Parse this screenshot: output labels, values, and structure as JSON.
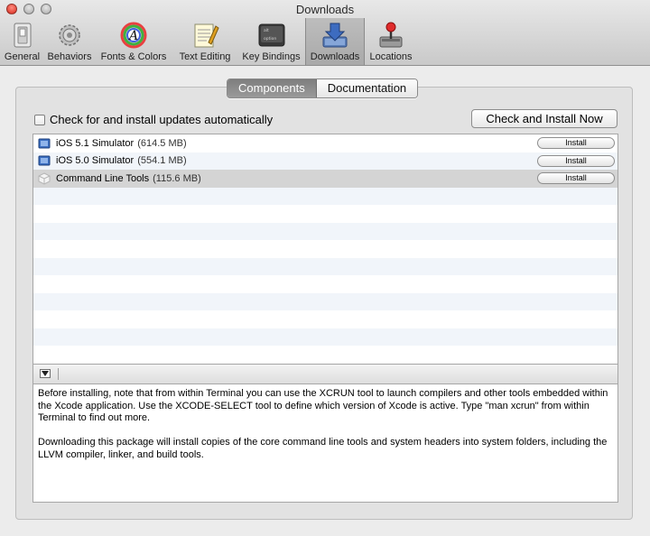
{
  "window": {
    "title": "Downloads"
  },
  "toolbar": {
    "items": [
      {
        "label": "General",
        "icon": "general-switch-icon"
      },
      {
        "label": "Behaviors",
        "icon": "behaviors-gears-icon"
      },
      {
        "label": "Fonts & Colors",
        "icon": "fonts-colors-icon"
      },
      {
        "label": "Text Editing",
        "icon": "text-editing-icon"
      },
      {
        "label": "Key Bindings",
        "icon": "key-bindings-icon",
        "key_caption_top": "alt",
        "key_caption_bottom": "option"
      },
      {
        "label": "Downloads",
        "icon": "downloads-icon",
        "selected": true
      },
      {
        "label": "Locations",
        "icon": "locations-joystick-icon"
      }
    ]
  },
  "tabs": [
    {
      "label": "Components",
      "active": true
    },
    {
      "label": "Documentation",
      "active": false
    }
  ],
  "auto_update": {
    "label": "Check for and install updates automatically",
    "checked": false
  },
  "check_button": {
    "label": "Check and Install Now"
  },
  "components": [
    {
      "name": "iOS 5.1 Simulator",
      "size": "(614.5 MB)",
      "button": "Install",
      "icon": "ios-simulator-icon"
    },
    {
      "name": "iOS 5.0 Simulator",
      "size": "(554.1 MB)",
      "button": "Install",
      "icon": "ios-simulator-icon"
    },
    {
      "name": "Command Line Tools",
      "size": "(115.6 MB)",
      "button": "Install",
      "icon": "package-icon",
      "highlighted": true
    }
  ],
  "details": {
    "paragraphs": [
      "Before installing, note that from within Terminal you can use the XCRUN tool to launch compilers and other tools embedded within the Xcode application. Use the XCODE-SELECT tool to define which version of Xcode is active.  Type \"man xcrun\" from within Terminal to find out more.",
      "Downloading this package will install copies of the core command line tools and system headers into system folders, including the LLVM compiler, linker, and build tools."
    ]
  },
  "colors": {
    "selected_tab": "#8a8a8a",
    "row_highlight": "#d4d4d4",
    "stripe": "#f1f5fa"
  }
}
